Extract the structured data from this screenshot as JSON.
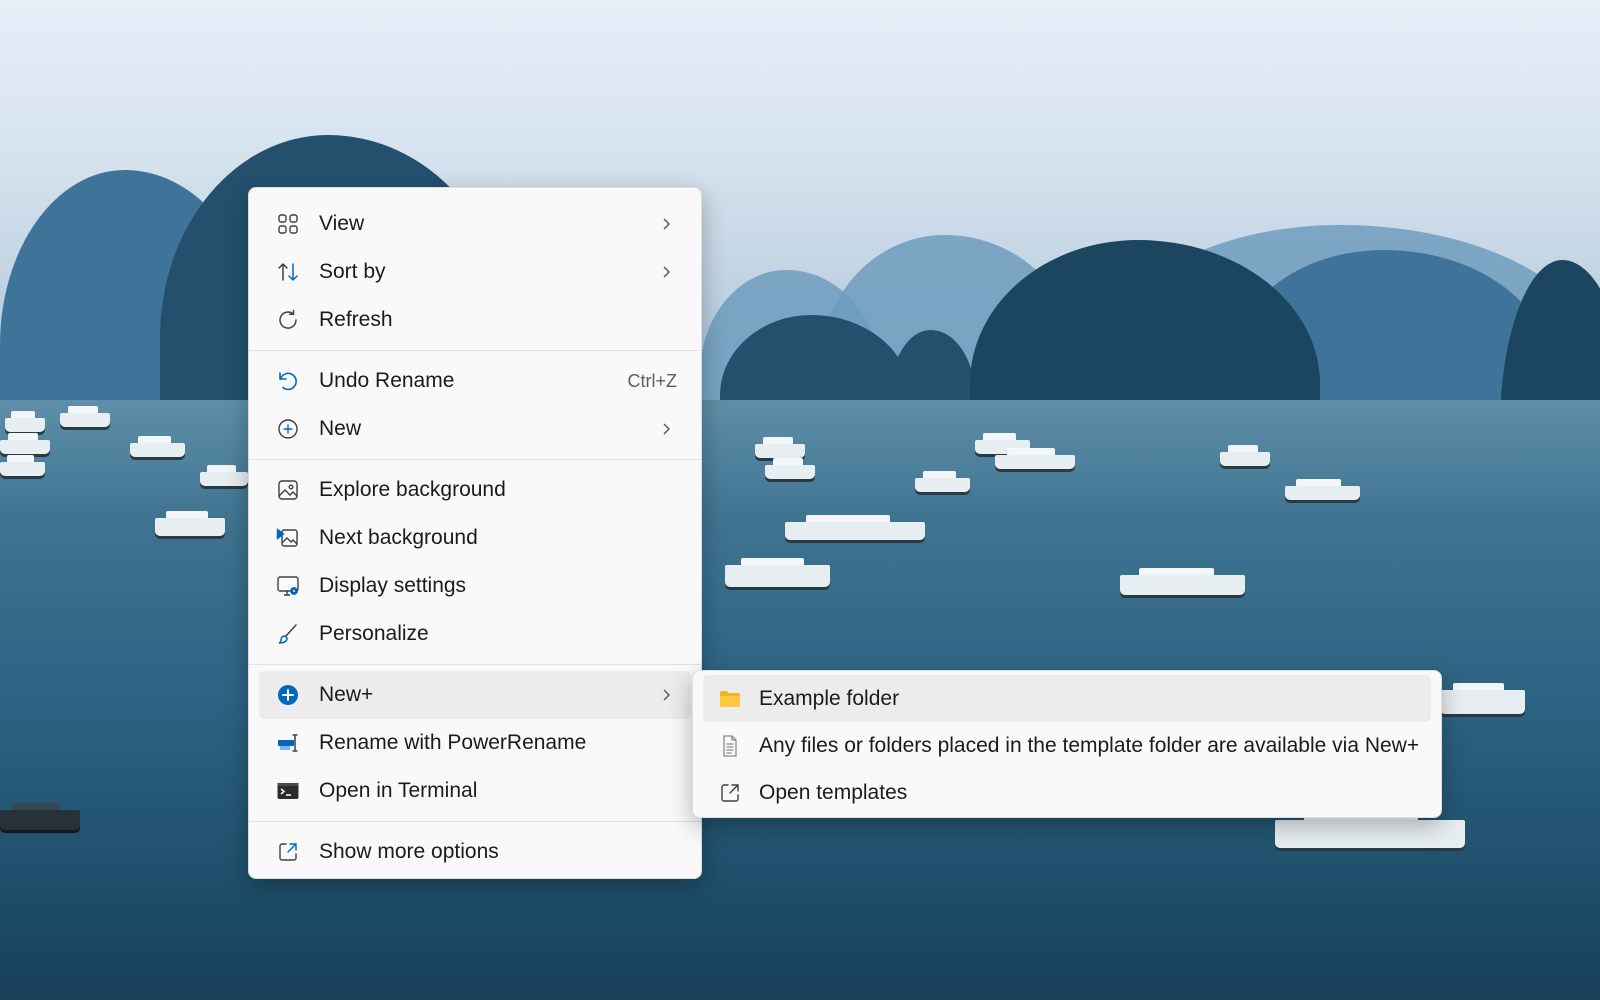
{
  "context_menu": {
    "items": [
      {
        "label": "View",
        "icon": "view-grid-icon",
        "submenu": true
      },
      {
        "label": "Sort by",
        "icon": "sort-icon",
        "submenu": true
      },
      {
        "label": "Refresh",
        "icon": "refresh-icon"
      },
      {
        "label": "Undo Rename",
        "icon": "undo-icon",
        "shortcut": "Ctrl+Z"
      },
      {
        "label": "New",
        "icon": "new-icon",
        "submenu": true
      },
      {
        "label": "Explore background",
        "icon": "explore-background-icon"
      },
      {
        "label": "Next background",
        "icon": "next-background-icon"
      },
      {
        "label": "Display settings",
        "icon": "display-settings-icon"
      },
      {
        "label": "Personalize",
        "icon": "personalize-brush-icon"
      },
      {
        "label": "New+",
        "icon": "new-plus-icon",
        "submenu": true
      },
      {
        "label": "Rename with PowerRename",
        "icon": "powerrename-icon"
      },
      {
        "label": "Open in Terminal",
        "icon": "terminal-icon"
      },
      {
        "label": "Show more options",
        "icon": "show-more-options-icon"
      }
    ]
  },
  "submenu_new_plus": {
    "items": [
      {
        "label": "Example folder",
        "icon": "folder-icon"
      },
      {
        "label": "Any files or folders placed in the template folder are available via New+",
        "icon": "document-icon"
      },
      {
        "label": "Open templates",
        "icon": "open-external-icon"
      }
    ]
  },
  "colors": {
    "accent": "#0067c0",
    "menu_background": "#f9f9f9",
    "active_item_background": "#ececec",
    "folder_yellow": "#ffc83d"
  }
}
